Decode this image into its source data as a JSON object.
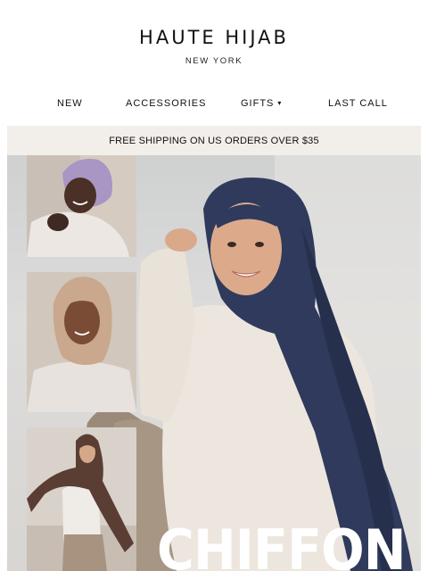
{
  "brand": {
    "name": "HAUTE HIJAB",
    "location": "NEW YORK"
  },
  "nav": {
    "items": [
      {
        "label": "NEW"
      },
      {
        "label": "ACCESSORIES"
      },
      {
        "label": "GIFTS",
        "has_dropdown": true,
        "caret": "▾"
      },
      {
        "label": "LAST CALL"
      }
    ]
  },
  "banner": {
    "text": "FREE SHIPPING ON US ORDERS OVER $35"
  },
  "hero": {
    "title": "CHIFFON"
  },
  "colors": {
    "banner_bg": "#f2eeea",
    "hijab_navy": "#2f3a5c",
    "text": "#111111"
  },
  "icons": {
    "dropdown": "chevron-down-icon"
  }
}
